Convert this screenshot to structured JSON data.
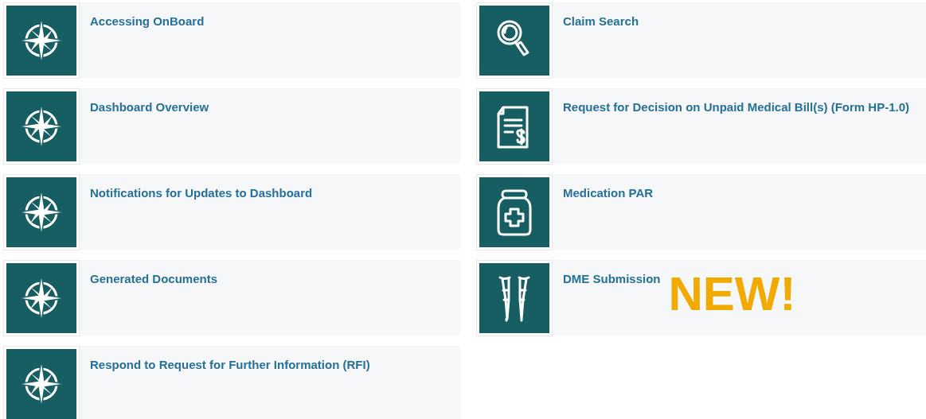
{
  "left_column": [
    {
      "title": "Accessing OnBoard",
      "kind": "compass"
    },
    {
      "title": "Dashboard Overview",
      "kind": "compass"
    },
    {
      "title": "Notifications for Updates to Dashboard",
      "kind": "compass"
    },
    {
      "title": "Generated Documents",
      "kind": "compass"
    },
    {
      "title": "Respond to Request for Further Information (RFI)",
      "kind": "compass"
    }
  ],
  "right_column": [
    {
      "title": "Claim Search",
      "kind": "search"
    },
    {
      "title": "Request for Decision on Unpaid Medical Bill(s) (Form HP-1.0)",
      "kind": "bill"
    },
    {
      "title": "Medication PAR",
      "kind": "medication"
    },
    {
      "title": "DME Submission",
      "kind": "crutches",
      "badge": "NEW!"
    }
  ]
}
